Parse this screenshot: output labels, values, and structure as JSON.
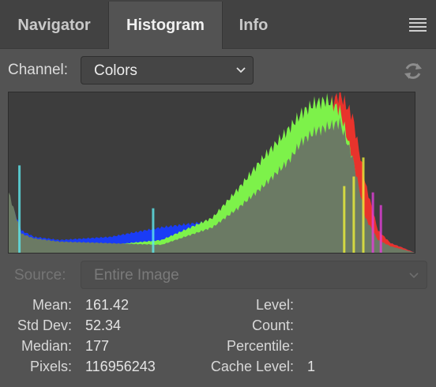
{
  "tabs": [
    {
      "label": "Navigator"
    },
    {
      "label": "Histogram"
    },
    {
      "label": "Info"
    }
  ],
  "active_tab": "Histogram",
  "channel": {
    "label": "Channel:",
    "value": "Colors"
  },
  "source": {
    "label": "Source:",
    "value": "Entire Image",
    "disabled": true
  },
  "stats_left": [
    {
      "label": "Mean:",
      "value": "161.42"
    },
    {
      "label": "Std Dev:",
      "value": "52.34"
    },
    {
      "label": "Median:",
      "value": "177"
    },
    {
      "label": "Pixels:",
      "value": "116956243"
    }
  ],
  "stats_right": [
    {
      "label": "Level:",
      "value": ""
    },
    {
      "label": "Count:",
      "value": ""
    },
    {
      "label": "Percentile:",
      "value": ""
    },
    {
      "label": "Cache Level:",
      "value": "1"
    }
  ],
  "icons": {
    "menu": "hamburger-menu-icon",
    "refresh": "refresh-icon",
    "dropdown": "chevron-down-icon"
  },
  "chart_data": {
    "type": "area",
    "x": [
      0,
      8,
      16,
      32,
      64,
      96,
      128,
      144,
      160,
      176,
      184,
      192,
      200,
      208,
      216,
      224,
      232,
      240,
      248,
      255
    ],
    "series": [
      {
        "color": "#6b7a64",
        "values": [
          38,
          12,
          9,
          7,
          6,
          5,
          16,
          28,
          42,
          58,
          70,
          76,
          79,
          82,
          60,
          22,
          8,
          4,
          2,
          0
        ]
      },
      {
        "color": "#e8332c",
        "values": [
          30,
          10,
          8,
          5,
          4,
          4,
          14,
          26,
          40,
          60,
          74,
          84,
          92,
          100,
          86,
          44,
          14,
          6,
          3,
          0
        ]
      },
      {
        "color": "#7df24a",
        "values": [
          32,
          11,
          9,
          6,
          5,
          8,
          22,
          40,
          60,
          78,
          88,
          94,
          96,
          90,
          60,
          20,
          6,
          2,
          1,
          0
        ]
      },
      {
        "color": "#1a3cf5",
        "values": [
          36,
          14,
          10,
          8,
          10,
          16,
          20,
          30,
          46,
          62,
          72,
          80,
          84,
          86,
          76,
          36,
          12,
          6,
          3,
          0
        ]
      }
    ],
    "accents": {
      "cyan": "#5fe8ee",
      "yellow": "#eef03a",
      "magenta": "#e23fd8"
    },
    "xlim": [
      0,
      255
    ],
    "ylim": [
      0,
      100
    ]
  }
}
